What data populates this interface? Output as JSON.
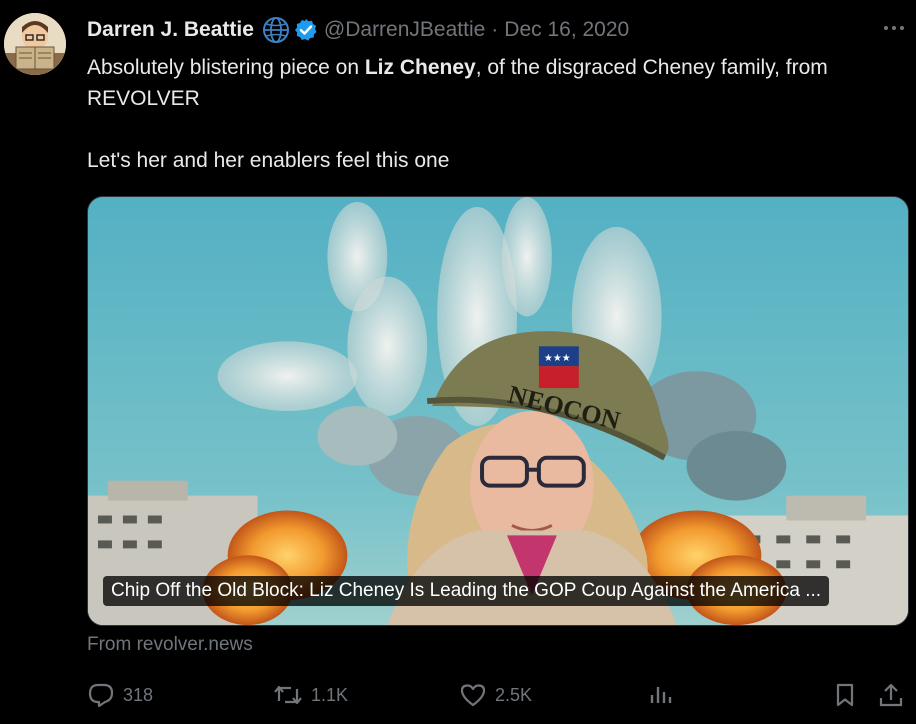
{
  "author": {
    "display_name": "Darren J. Beattie",
    "handle": "@DarrenJBeattie",
    "separator": "·",
    "date": "Dec 16, 2020"
  },
  "icons": {
    "globe": "globe-icon",
    "verified": "verified-badge-icon",
    "more": "more-options-icon",
    "reply": "reply-icon",
    "repost": "repost-icon",
    "like": "like-icon",
    "views": "views-icon",
    "bookmark": "bookmark-icon",
    "share": "share-icon"
  },
  "tweet": {
    "text_part1": "Absolutely blistering piece on ",
    "text_bold": "Liz Cheney",
    "text_part2": ", of the disgraced Cheney family, from REVOLVER",
    "text_line2": "Let's her and her enablers feel this one"
  },
  "card": {
    "title": "Chip Off the Old Block: Liz Cheney Is Leading the GOP Coup Against the America ...",
    "helmet_text": "NEOCON",
    "source": "From revolver.news"
  },
  "actions": {
    "replies": "318",
    "reposts": "1.1K",
    "likes": "2.5K"
  },
  "colors": {
    "background": "#000000",
    "text_primary": "#e7e9ea",
    "text_secondary": "#71767b",
    "verified_blue": "#1d9bf0",
    "globe_blue": "#3b82c4"
  }
}
